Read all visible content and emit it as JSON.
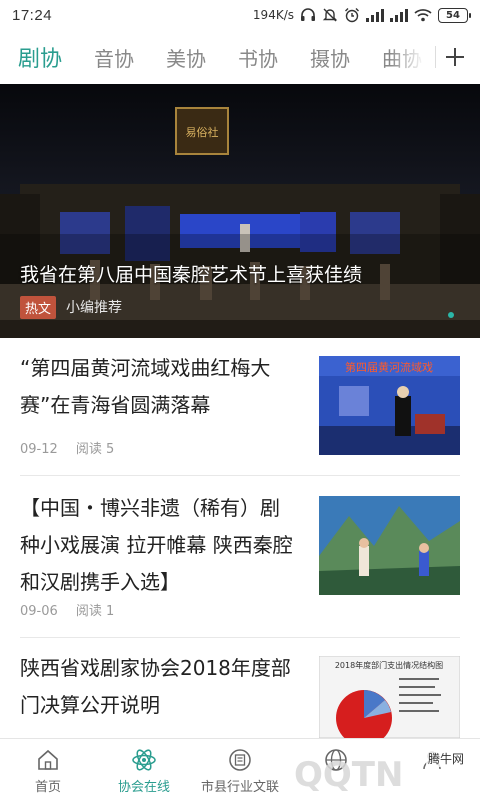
{
  "status_bar": {
    "time": "17:24",
    "speed": "194K/s",
    "battery": "54"
  },
  "tabs": {
    "items": [
      "剧协",
      "音协",
      "美协",
      "书协",
      "摄协",
      "曲协"
    ],
    "active_index": 0
  },
  "hero": {
    "title": "我省在第八届中国秦腔艺术节上喜获佳绩",
    "badge": "热文",
    "source": "小编推荐",
    "plaque_text": "易俗社"
  },
  "news": [
    {
      "title": "“第四届黄河流域戏曲红梅大赛”在青海省圆满落幕",
      "date": "09-12",
      "reads": "阅读 5",
      "thumb_caption": "第四届黄河流域戏"
    },
    {
      "title": "【中国・博兴非遗（稀有）剧种小戏展演 拉开帷幕 陕西秦腔和汉剧携手入选】",
      "date": "09-06",
      "reads": "阅读 1"
    },
    {
      "title": "陕西省戏剧家协会2018年度部门决算公开说明",
      "thumb_caption": "2018年度部门支出情况结构图"
    }
  ],
  "bottom_nav": {
    "items": [
      "首页",
      "协会在线",
      "市县行业文联",
      "",
      ""
    ],
    "active_index": 1
  },
  "watermark": "腾牛网",
  "colors": {
    "accent": "#2a9d8f",
    "badge": "#c0533c"
  }
}
